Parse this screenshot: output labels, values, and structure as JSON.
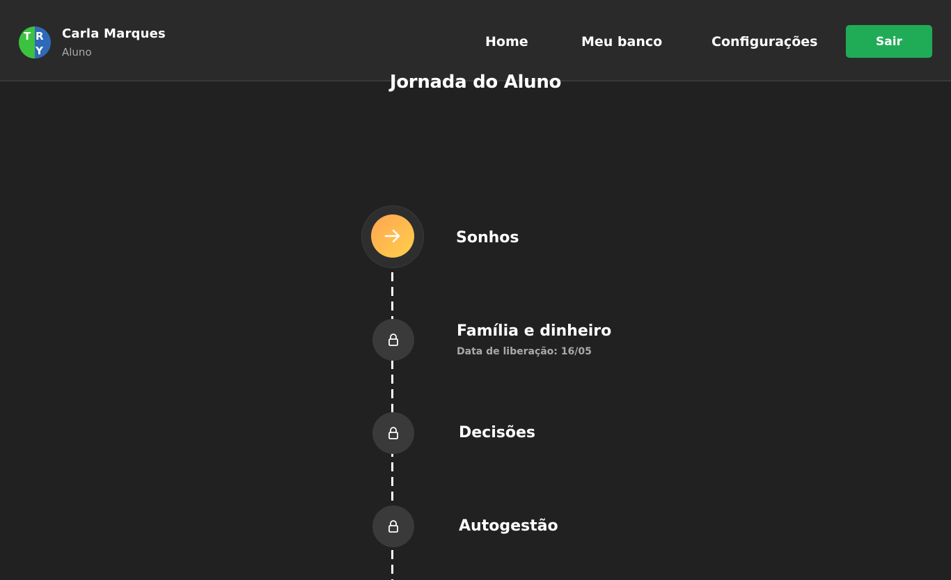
{
  "user": {
    "name": "Carla Marques",
    "role": "Aluno",
    "logo_letters": [
      "T",
      "R",
      "Y"
    ]
  },
  "nav": {
    "home": "Home",
    "bank": "Meu banco",
    "settings": "Configurações"
  },
  "actions": {
    "logout_label": "Sair"
  },
  "page": {
    "title": "Jornada do Aluno"
  },
  "journey": {
    "steps": [
      {
        "label": "Sonhos",
        "status": "active",
        "icon": "arrow-right-icon"
      },
      {
        "label": "Família e dinheiro",
        "status": "locked",
        "icon": "lock-icon",
        "release": "Data de liberação: 16/05"
      },
      {
        "label": "Decisões",
        "status": "locked",
        "icon": "lock-icon"
      },
      {
        "label": "Autogestão",
        "status": "locked",
        "icon": "lock-icon"
      }
    ]
  },
  "colors": {
    "background": "#212121",
    "header": "#2b2a2a",
    "accent_green": "#20ac56",
    "active_gradient": [
      "#ffa552",
      "#ffcf4a"
    ],
    "locked_circle": "#3a3a3a",
    "logo_green": "#3cc23f",
    "logo_blue": "#2f6ab8"
  }
}
